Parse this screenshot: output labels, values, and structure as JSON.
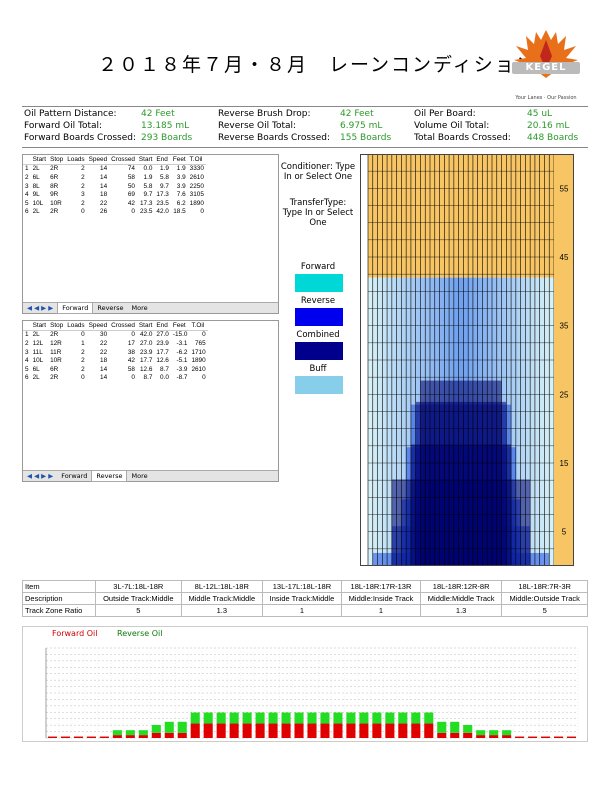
{
  "header": {
    "title": "２０１８年７月・８月　レーンコンディション",
    "logo_text": "KEGEL",
    "logo_sub": "Your Lanes · Our Passion"
  },
  "stats": {
    "col1": [
      {
        "label": "Oil Pattern Distance:",
        "value": "42 Feet"
      },
      {
        "label": "Forward Oil Total:",
        "value": "13.185 mL"
      },
      {
        "label": "Forward Boards Crossed:",
        "value": "293 Boards"
      }
    ],
    "col2": [
      {
        "label": "Reverse Brush Drop:",
        "value": "42 Feet"
      },
      {
        "label": "Reverse Oil Total:",
        "value": "6.975 mL"
      },
      {
        "label": "Reverse Boards Crossed:",
        "value": "155 Boards"
      }
    ],
    "col3": [
      {
        "label": "Oil Per Board:",
        "value": "45 uL"
      },
      {
        "label": "Volume Oil Total:",
        "value": "20.16 mL"
      },
      {
        "label": "Total Boards Crossed:",
        "value": "448 Boards"
      }
    ]
  },
  "forward_table": {
    "headers": [
      "",
      "Start",
      "Stop",
      "Loads",
      "Speed",
      "Crossed",
      "Start",
      "End",
      "Feet",
      "T.Oil"
    ],
    "rows": [
      [
        "1",
        "2L",
        "2R",
        "2",
        "14",
        "74",
        "0.0",
        "1.9",
        "1.9",
        "3330"
      ],
      [
        "2",
        "6L",
        "6R",
        "2",
        "14",
        "58",
        "1.9",
        "5.8",
        "3.9",
        "2610"
      ],
      [
        "3",
        "8L",
        "8R",
        "2",
        "14",
        "50",
        "5.8",
        "9.7",
        "3.9",
        "2250"
      ],
      [
        "4",
        "9L",
        "9R",
        "3",
        "18",
        "69",
        "9.7",
        "17.3",
        "7.6",
        "3105"
      ],
      [
        "5",
        "10L",
        "10R",
        "2",
        "22",
        "42",
        "17.3",
        "23.5",
        "6.2",
        "1890"
      ],
      [
        "6",
        "2L",
        "2R",
        "0",
        "26",
        "0",
        "23.5",
        "42.0",
        "18.5",
        "0"
      ]
    ],
    "tabs": [
      "Forward",
      "Reverse",
      "More"
    ],
    "active_tab": "Forward"
  },
  "reverse_table": {
    "headers": [
      "",
      "Start",
      "Stop",
      "Loads",
      "Speed",
      "Crossed",
      "Start",
      "End",
      "Feet",
      "T.Oil"
    ],
    "rows": [
      [
        "1",
        "2L",
        "2R",
        "0",
        "30",
        "0",
        "42.0",
        "27.0",
        "-15.0",
        "0"
      ],
      [
        "2",
        "12L",
        "12R",
        "1",
        "22",
        "17",
        "27.0",
        "23.9",
        "-3.1",
        "765"
      ],
      [
        "3",
        "11L",
        "11R",
        "2",
        "22",
        "38",
        "23.9",
        "17.7",
        "-6.2",
        "1710"
      ],
      [
        "4",
        "10L",
        "10R",
        "2",
        "18",
        "42",
        "17.7",
        "12.6",
        "-5.1",
        "1890"
      ],
      [
        "5",
        "6L",
        "6R",
        "2",
        "14",
        "58",
        "12.6",
        "8.7",
        "-3.9",
        "2610"
      ],
      [
        "6",
        "2L",
        "2R",
        "0",
        "14",
        "0",
        "8.7",
        "0.0",
        "-8.7",
        "0"
      ]
    ],
    "tabs": [
      "Forward",
      "Reverse",
      "More"
    ],
    "active_tab": "Reverse"
  },
  "side": {
    "conditioner": "Conditioner: Type In or Select One",
    "transfer": "TransferType: Type In or Select One",
    "legend": [
      {
        "label": "Forward",
        "color": "#00d8d8"
      },
      {
        "label": "Reverse",
        "color": "#0000ee"
      },
      {
        "label": "Combined",
        "color": "#00008c"
      },
      {
        "label": "Buff",
        "color": "#87ceeb"
      }
    ]
  },
  "lane_graph": {
    "feet_labels": [
      "55",
      "45",
      "35",
      "25",
      "15",
      "5"
    ],
    "max_feet": 60,
    "pattern_feet": 42
  },
  "zones": {
    "item_label": "Item",
    "description_label": "Description",
    "ratio_label": "Track Zone Ratio",
    "items": [
      "3L-7L:18L-18R",
      "8L-12L:18L-18R",
      "13L-17L:18L-18R",
      "18L-18R:17R-13R",
      "18L-18R:12R-8R",
      "18L-18R:7R-3R"
    ],
    "descriptions": [
      "Outside Track:Middle",
      "Middle Track:Middle",
      "Inside Track:Middle",
      "Middle:Inside Track",
      "Middle:Middle Track",
      "Middle:Outside Track"
    ],
    "ratios": [
      "5",
      "1.3",
      "1",
      "1",
      "1.3",
      "5"
    ]
  },
  "chart_data": {
    "type": "bar",
    "series": [
      {
        "name": "Forward Oil",
        "color": "#e00000",
        "values": [
          225,
          225,
          225,
          225,
          225,
          450,
          450,
          450,
          810,
          810,
          810,
          2250,
          2250,
          2250,
          2250,
          2250,
          2250,
          2250,
          2250,
          2250,
          2250,
          2250,
          2250,
          2250,
          2250,
          2250,
          2250,
          2250,
          2250,
          2250,
          810,
          810,
          810,
          450,
          450,
          450,
          225,
          225,
          225,
          225,
          225
        ]
      },
      {
        "name": "Reverse Oil",
        "color": "#22dd22",
        "values": [
          0,
          0,
          0,
          0,
          0,
          765,
          765,
          765,
          1215,
          1710,
          1710,
          1710,
          1710,
          1710,
          1710,
          1710,
          1710,
          1710,
          1710,
          1710,
          1710,
          1710,
          1710,
          1710,
          1710,
          1710,
          1710,
          1710,
          1710,
          1710,
          1710,
          1710,
          1215,
          765,
          765,
          765,
          0,
          0,
          0,
          0,
          0
        ]
      }
    ],
    "ylim": [
      0,
      14000
    ]
  }
}
